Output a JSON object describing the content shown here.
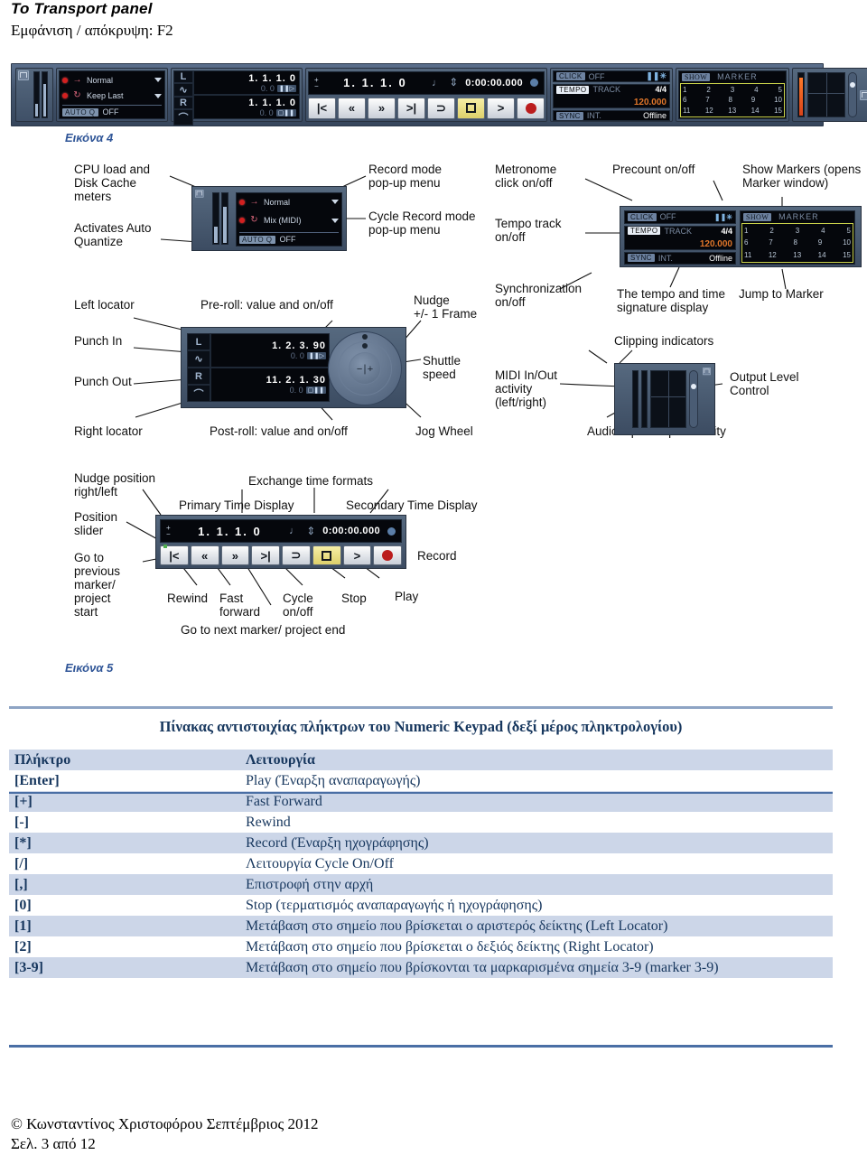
{
  "header": {
    "title": "Το Transport panel",
    "subtitle": "Εμφάνιση / απόκρυψη: F2"
  },
  "figure4": {
    "caption": "Εικόνα 4",
    "record_mode": "Normal",
    "cycle_record_mode": "Keep Last",
    "auto_q_tag": "AUTO Q",
    "auto_q_value": "OFF",
    "left_locator_label": "L",
    "right_locator_label": "R",
    "left_locator_value": "1. 1. 1.  0",
    "left_preroll_value": "0.   0",
    "right_locator_value": "1. 1. 1.  0",
    "right_postroll_value": "0.   0",
    "primary_time": "1. 1. 1.   0",
    "secondary_time": "0:00:00.000",
    "click_tag": "CLICK",
    "click_value": "OFF",
    "tempo_tag": "TEMPO",
    "tempo_track": "TRACK",
    "time_signature": "4/4",
    "tempo_value": "120.000",
    "sync_tag": "SYNC",
    "sync_source": "INT.",
    "sync_status": "Offline",
    "show_tag": "SHOW",
    "marker_tag": "MARKER",
    "marker_rows": [
      [
        "1",
        "2",
        "3",
        "4",
        "5"
      ],
      [
        "6",
        "7",
        "8",
        "9",
        "10"
      ],
      [
        "11",
        "12",
        "13",
        "14",
        "15"
      ]
    ]
  },
  "figure5": {
    "caption": "Εικόνα 5",
    "annotations": [
      "CPU load and\nDisk Cache\nmeters",
      "Activates Auto\nQuantize",
      "Record mode\npop-up menu",
      "Cycle Record mode\npop-up menu",
      "Metronome\nclick on/off",
      "Tempo track\non/off",
      "Precount on/off",
      "Show Markers (opens\nMarker window)",
      "Synchronization\non/off",
      "The tempo and time\nsignature display",
      "Jump to Marker",
      "Left locator",
      "Punch In",
      "Punch Out",
      "Right locator",
      "Pre-roll: value and on/off",
      "Post-roll: value and on/off",
      "Nudge\n+/- 1 Frame",
      "Shuttle\nspeed",
      "Jog Wheel",
      "Clipping indicators",
      "MIDI In/Out\nactivity\n(left/right)",
      "Output Level\nControl",
      "Audio input/output activity",
      "Nudge position\nright/left",
      "Position\nslider",
      "Go to\nprevious\nmarker/\nproject\nstart",
      "Primary Time Display",
      "Exchange time formats",
      "Secondary Time Display",
      "Rewind",
      "Fast\nforward",
      "Cycle\non/off",
      "Stop",
      "Play",
      "Record",
      "Go to next marker/ project end"
    ],
    "panel_a": {
      "record_mode": "Normal",
      "cycle_record_mode": "Mix (MIDI)",
      "auto_q_tag": "AUTO Q",
      "auto_q_value": "OFF"
    },
    "panel_b": {
      "click_tag": "CLICK",
      "click_value": "OFF",
      "tempo_tag": "TEMPO",
      "tempo_track": "TRACK",
      "time_signature": "4/4",
      "tempo_value": "120.000",
      "sync_tag": "SYNC",
      "sync_source": "INT.",
      "sync_status": "Offline",
      "show_tag": "SHOW",
      "marker_tag": "MARKER",
      "marker_rows": [
        [
          "1",
          "2",
          "3",
          "4",
          "5"
        ],
        [
          "6",
          "7",
          "8",
          "9",
          "10"
        ],
        [
          "11",
          "12",
          "13",
          "14",
          "15"
        ]
      ]
    },
    "panel_c": {
      "left_label": "L",
      "right_label": "R",
      "left_locator_value": "1. 2. 3. 90",
      "left_preroll_value": "0.    0",
      "right_locator_value": "11. 2. 1. 30",
      "right_postroll_value": "0.    0"
    },
    "panel_d": {
      "primary_time": "1. 1. 1.   0",
      "secondary_time": "0:00:00.000"
    }
  },
  "table": {
    "title": "Πίνακας αντιστοιχίας πλήκτρων του Numeric Keypad (δεξί  μέρος πληκτρολογίου)",
    "header": {
      "key": "Πλήκτρο",
      "function": "Λειτουργία"
    },
    "rows": [
      {
        "key": "[Enter]",
        "function": "Play (Έναρξη αναπαραγωγής)"
      },
      {
        "key": "[+]",
        "function": "Fast Forward"
      },
      {
        "key": "[-]",
        "function": "Rewind"
      },
      {
        "key": "[*]",
        "function": "Record (Έναρξη ηχογράφησης)"
      },
      {
        "key": "[/]",
        "function": "Λειτουργία Cycle On/Off"
      },
      {
        "key": "[,]",
        "function": "Επιστροφή στην αρχή"
      },
      {
        "key": "[0]",
        "function": "Stop (τερματισμός αναπαραγωγής ή ηχογράφησης)"
      },
      {
        "key": "[1]",
        "function": "Μετάβαση στο σημείο που βρίσκεται ο αριστερός δείκτης (Left Locator)"
      },
      {
        "key": "[2]",
        "function": "Μετάβαση στο σημείο που βρίσκεται ο δεξιός δείκτης (Right Locator)"
      },
      {
        "key": "[3-9]",
        "function": "Μετάβαση στο σημείο που βρίσκονται τα μαρκαρισμένα σημεία 3-9  (marker 3-9)"
      }
    ]
  },
  "footer": {
    "copyright": "© Κωνσταντίνος Χριστοφόρου Σεπτέμβριος  2012",
    "page": " Σελ. 3 από 12"
  }
}
